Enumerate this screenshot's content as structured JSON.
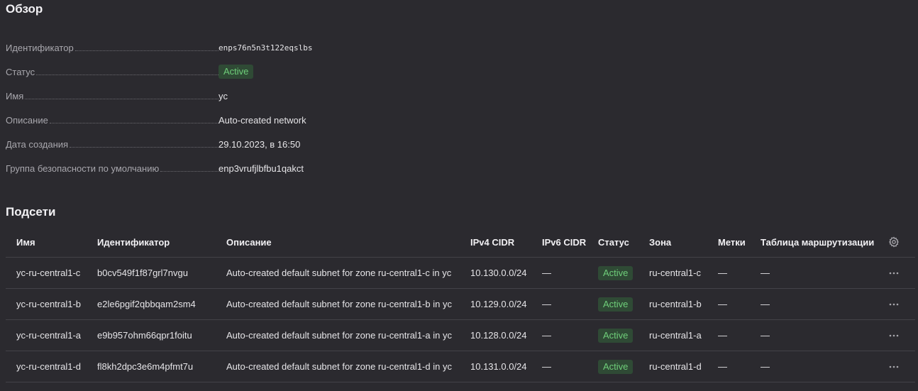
{
  "overview": {
    "title": "Обзор",
    "fields": [
      {
        "label": "Идентификатор",
        "value": "enps76n5n3t122eqslbs"
      },
      {
        "label": "Статус",
        "value": "Active"
      },
      {
        "label": "Имя",
        "value": "yc"
      },
      {
        "label": "Описание",
        "value": "Auto-created network"
      },
      {
        "label": "Дата создания",
        "value": "29.10.2023, в 16:50"
      },
      {
        "label": "Группа безопасности по умолчанию",
        "value": "enp3vrufjlbfbu1qakct"
      }
    ]
  },
  "subnets": {
    "title": "Подсети",
    "columns": {
      "name": "Имя",
      "id": "Идентификатор",
      "description": "Описание",
      "ipv4": "IPv4 CIDR",
      "ipv6": "IPv6 CIDR",
      "status": "Статус",
      "zone": "Зона",
      "labels": "Метки",
      "route_table": "Таблица маршрутизации"
    },
    "rows": [
      {
        "name": "yc-ru-central1-c",
        "id": "b0cv549f1f87grl7nvgu",
        "description": "Auto-created default subnet for zone ru-central1-c in yc",
        "ipv4": "10.130.0.0/24",
        "ipv6": "—",
        "status": "Active",
        "zone": "ru-central1-c",
        "labels": "—",
        "route_table": "—"
      },
      {
        "name": "yc-ru-central1-b",
        "id": "e2le6pgif2qbbqam2sm4",
        "description": "Auto-created default subnet for zone ru-central1-b in yc",
        "ipv4": "10.129.0.0/24",
        "ipv6": "—",
        "status": "Active",
        "zone": "ru-central1-b",
        "labels": "—",
        "route_table": "—"
      },
      {
        "name": "yc-ru-central1-a",
        "id": "e9b957ohm66qpr1foitu",
        "description": "Auto-created default subnet for zone ru-central1-a in yc",
        "ipv4": "10.128.0.0/24",
        "ipv6": "—",
        "status": "Active",
        "zone": "ru-central1-a",
        "labels": "—",
        "route_table": "—"
      },
      {
        "name": "yc-ru-central1-d",
        "id": "fl8kh2dpc3e6m4pfmt7u",
        "description": "Auto-created default subnet for zone ru-central1-d in yc",
        "ipv4": "10.131.0.0/24",
        "ipv6": "—",
        "status": "Active",
        "zone": "ru-central1-d",
        "labels": "—",
        "route_table": "—"
      }
    ]
  },
  "colors": {
    "background": "#2b2a2f",
    "active_badge_bg": "#2f4a35",
    "active_badge_text": "#6fcf7a",
    "divider": "#434248"
  },
  "icons": {
    "settings": "gear-icon",
    "row_menu": "more-horizontal-icon"
  }
}
